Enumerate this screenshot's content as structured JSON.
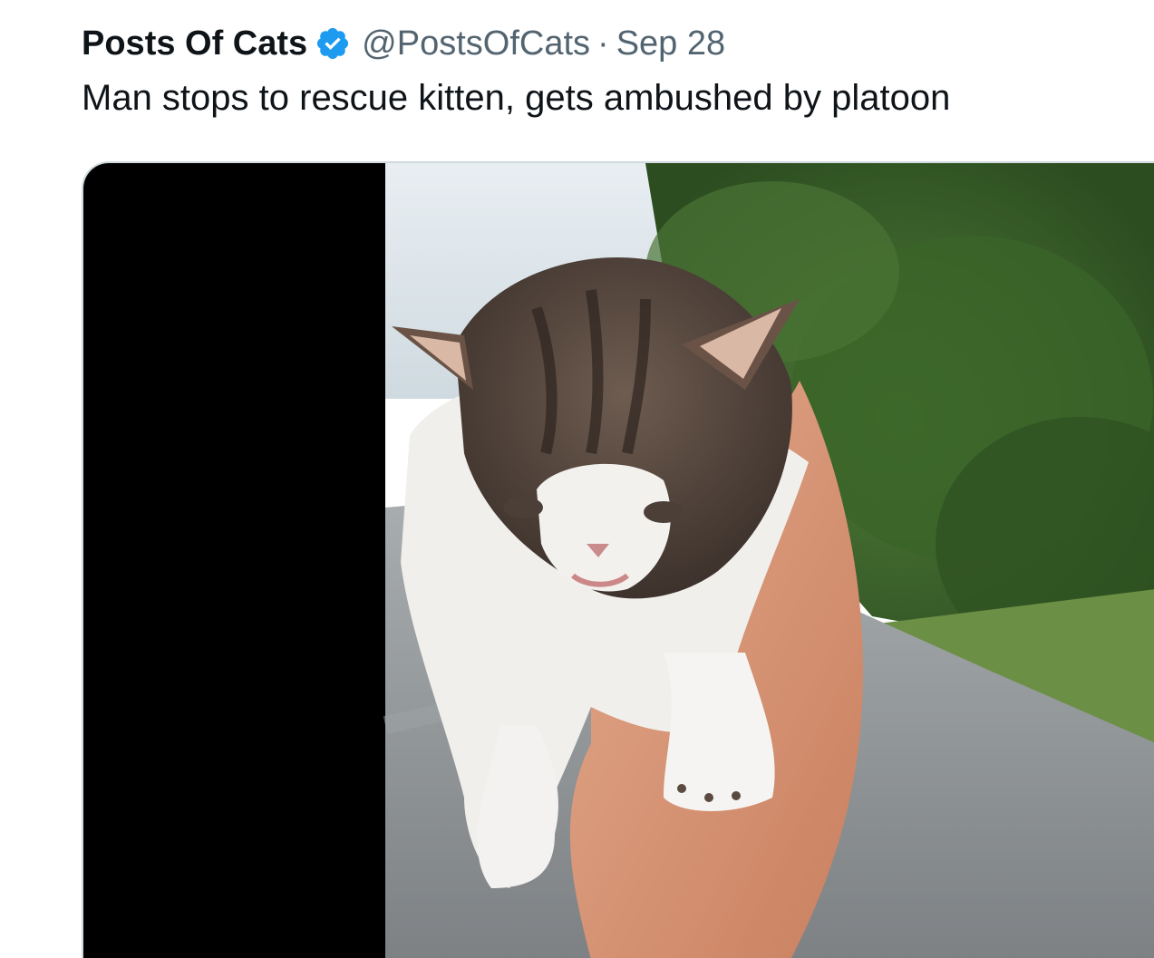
{
  "tweet": {
    "display_name": "Posts Of Cats",
    "verified_icon": "verified-badge-icon",
    "handle": "@PostsOfCats",
    "separator": "·",
    "date": "Sep 28",
    "text": "Man stops to rescue kitten, gets ambushed by platoon"
  },
  "media": {
    "type": "video-frame",
    "subject": "kitten held in hand on road",
    "colors": {
      "letterbox": "#000000",
      "foliage": "#3f6a2c",
      "road": "#8d9092",
      "sky": "#dfe8ee",
      "skin": "#d9967a",
      "fur_dark": "#5a4a40",
      "fur_light": "#f4f2f0"
    }
  },
  "colors": {
    "verified_blue": "#1d9bf0",
    "text_primary": "#0f1419",
    "text_secondary": "#536471"
  }
}
